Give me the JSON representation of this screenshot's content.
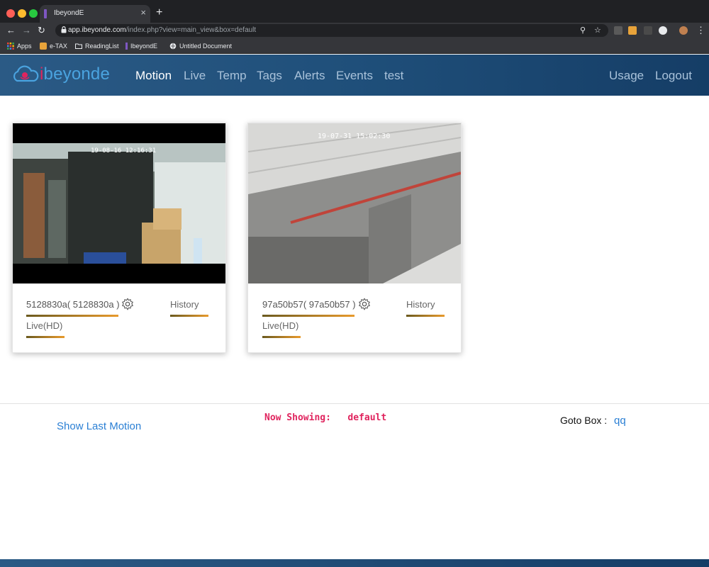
{
  "browser": {
    "tab_title": "IbeyondE",
    "tab_close": "×",
    "new_tab": "+",
    "url_host": "app.ibeyonde.com",
    "url_path": "/index.php?view=main_view&box=default",
    "bookmarks": [
      {
        "label": "Apps"
      },
      {
        "label": "e-TAX"
      },
      {
        "label": "ReadingList"
      },
      {
        "label": "IbeyondE"
      },
      {
        "label": "Untitled Document"
      }
    ]
  },
  "app": {
    "logo_first": "i",
    "logo_rest": "beyonde",
    "nav": [
      {
        "label": "Motion",
        "active": true
      },
      {
        "label": "Live"
      },
      {
        "label": "Temp"
      },
      {
        "label": "Tags"
      },
      {
        "label": "Alerts"
      },
      {
        "label": "Events"
      },
      {
        "label": "test"
      }
    ],
    "nav_right": [
      {
        "label": "Usage"
      },
      {
        "label": "Logout"
      }
    ]
  },
  "cameras": [
    {
      "id_label": "5128830a( 5128830a )",
      "timestamp": "19-08-16 12:16:31",
      "history_label": "History",
      "live_label": "Live(HD)"
    },
    {
      "id_label": "97a50b57( 97a50b57 )",
      "timestamp": "19-07-31 15:02:30",
      "history_label": "History",
      "live_label": "Live(HD)"
    }
  ],
  "footer": {
    "show_last_motion": "Show Last Motion",
    "now_showing_label": "Now Showing:",
    "now_showing_value": "default",
    "goto_label": "Goto Box :",
    "goto_value": "qq"
  },
  "colors": {
    "accent_pink": "#e0245e",
    "link_blue": "#2a7fd4",
    "navbar": "#1f4f7a",
    "underline_start": "#6b5a1f",
    "underline_end": "#e89a2c"
  }
}
